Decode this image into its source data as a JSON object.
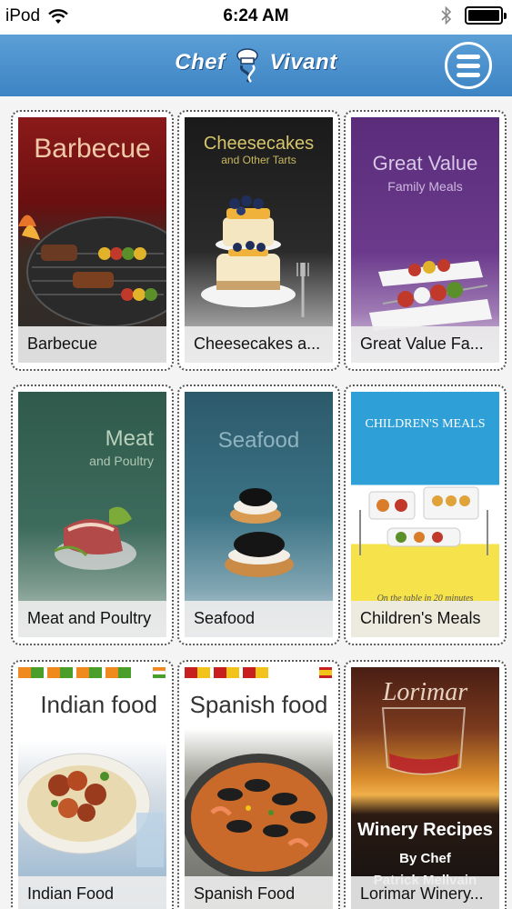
{
  "status_bar": {
    "carrier": "iPod",
    "time": "6:24 AM",
    "icons": [
      "wifi-icon",
      "bluetooth-icon",
      "battery-icon"
    ]
  },
  "header": {
    "logo_left": "Chef",
    "logo_right": "Vivant",
    "menu_icon": "hamburger-menu-icon",
    "color": "#4a90cf"
  },
  "books": [
    {
      "label": "Barbecue",
      "cover_title": "Barbecue",
      "cover_subtitle": ""
    },
    {
      "label": "Cheesecakes a...",
      "cover_title": "Cheesecakes",
      "cover_subtitle": "and Other Tarts"
    },
    {
      "label": "Great Value Fa...",
      "cover_title": "Great Value",
      "cover_subtitle": "Family Meals"
    },
    {
      "label": "Meat and Poultry",
      "cover_title": "Meat",
      "cover_subtitle": "and Poultry"
    },
    {
      "label": "Seafood",
      "cover_title": "Seafood",
      "cover_subtitle": ""
    },
    {
      "label": "Children's Meals",
      "cover_title": "CHILDREN'S MEALS",
      "cover_subtitle": "On the table in 20 minutes"
    },
    {
      "label": "Indian Food",
      "cover_title": "Indian food",
      "cover_subtitle": ""
    },
    {
      "label": "Spanish Food",
      "cover_title": "Spanish food",
      "cover_subtitle": ""
    },
    {
      "label": "Lorimar Winery...",
      "cover_title": "Lorimar",
      "cover_subtitle": "Winery Recipes",
      "cover_extra_1": "By Chef",
      "cover_extra_2": "Patrick Mellvain"
    }
  ]
}
